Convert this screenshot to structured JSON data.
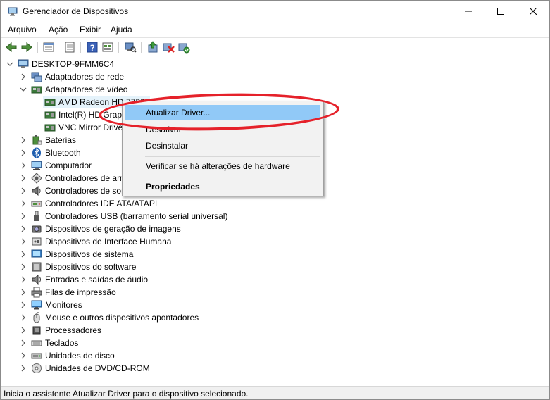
{
  "window": {
    "title": "Gerenciador de Dispositivos",
    "controls": {
      "minimize": "—",
      "maximize": "☐",
      "close": "✕"
    }
  },
  "menu": [
    "Arquivo",
    "Ação",
    "Exibir",
    "Ajuda"
  ],
  "tree": {
    "root": "DESKTOP-9FMM6C4",
    "items": [
      {
        "label": "Adaptadores de rede",
        "icon": "network-icon",
        "expanded": false
      },
      {
        "label": "Adaptadores de vídeo",
        "icon": "display-adapter-icon",
        "expanded": true,
        "children": [
          "AMD Radeon HD 7730M",
          "Intel(R) HD Graphics",
          "VNC Mirror Driver"
        ]
      },
      {
        "label": "Baterias",
        "icon": "battery-icon"
      },
      {
        "label": "Bluetooth",
        "icon": "bluetooth-icon"
      },
      {
        "label": "Computador",
        "icon": "computer-icon"
      },
      {
        "label": "Controladores de armazenamento",
        "icon": "storage-controller-icon"
      },
      {
        "label": "Controladores de som, vídeo e jogos",
        "icon": "sound-icon"
      },
      {
        "label": "Controladores IDE ATA/ATAPI",
        "icon": "ide-icon"
      },
      {
        "label": "Controladores USB (barramento serial universal)",
        "icon": "usb-icon"
      },
      {
        "label": "Dispositivos de geração de imagens",
        "icon": "camera-icon"
      },
      {
        "label": "Dispositivos de Interface Humana",
        "icon": "hid-icon"
      },
      {
        "label": "Dispositivos de sistema",
        "icon": "system-device-icon"
      },
      {
        "label": "Dispositivos do software",
        "icon": "software-device-icon"
      },
      {
        "label": "Entradas e saídas de áudio",
        "icon": "audio-io-icon"
      },
      {
        "label": "Filas de impressão",
        "icon": "printer-icon"
      },
      {
        "label": "Monitores",
        "icon": "monitor-icon"
      },
      {
        "label": "Mouse e outros dispositivos apontadores",
        "icon": "mouse-icon"
      },
      {
        "label": "Processadores",
        "icon": "processor-icon"
      },
      {
        "label": "Teclados",
        "icon": "keyboard-icon"
      },
      {
        "label": "Unidades de disco",
        "icon": "disk-icon"
      },
      {
        "label": "Unidades de DVD/CD-ROM",
        "icon": "dvd-icon"
      }
    ]
  },
  "context_menu": {
    "items": [
      "Atualizar Driver...",
      "Desativar",
      "Desinstalar",
      "Verificar se há alterações de hardware",
      "Propriedades"
    ]
  },
  "status": "Inicia o assistente Atualizar Driver para o dispositivo selecionado.",
  "colors": {
    "highlight": "#91c9f7",
    "selection": "#e5f3fb",
    "annotation": "#e5212a"
  }
}
